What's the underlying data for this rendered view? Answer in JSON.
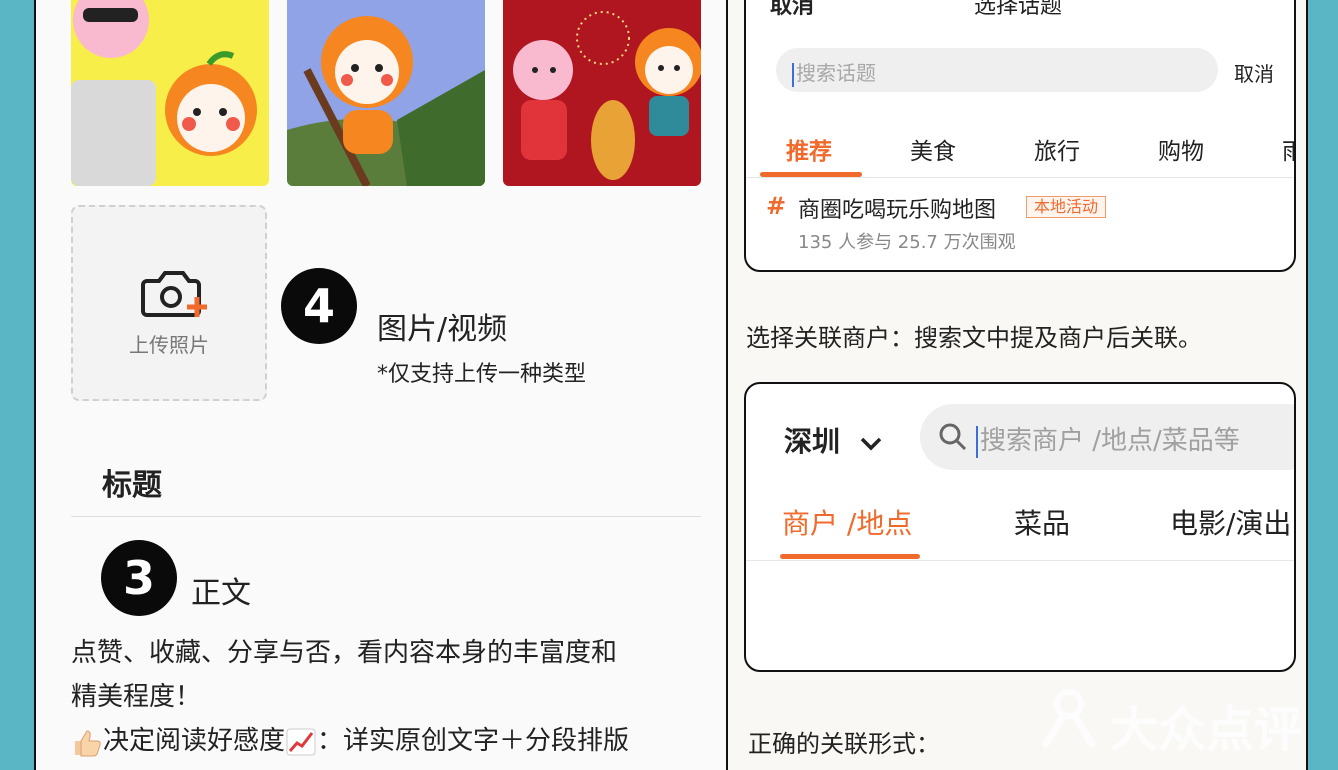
{
  "left": {
    "thumbnails": [
      "travel-image",
      "zongzi-image",
      "festival-image"
    ],
    "upload": {
      "label": "上传照片"
    },
    "step4": {
      "number": "4",
      "title": "图片/视频",
      "note": "*仅支持上传一种类型"
    },
    "title_field": {
      "label": "标题"
    },
    "step3": {
      "number": "3",
      "title": "正文"
    },
    "body_lines": [
      "点赞、收藏、分享与否，看内容本身的丰富度和",
      "精美程度！",
      "决定阅读好感度",
      "：详实原创文字＋分段排版"
    ]
  },
  "right": {
    "top_header": {
      "cancel": "取消",
      "title": "选择话题"
    },
    "topic_search": {
      "placeholder": "搜索话题",
      "cancel": "取消"
    },
    "topic_tabs": [
      "推荐",
      "美食",
      "旅行",
      "购物",
      "雨"
    ],
    "topic_item": {
      "hash": "#",
      "name": "商圈吃喝玩乐购地图",
      "badge": "本地活动",
      "stats": "135 人参与 25.7 万次围观"
    },
    "merchant_note": "选择关联商户：搜索文中提及商户后关联。",
    "merchant_card": {
      "city": "深圳",
      "search_placeholder": "搜索商户 /地点/菜品等",
      "tabs": [
        "商户 /地点",
        "菜品",
        "电影/演出"
      ]
    },
    "correct_form": "正确的关联形式：",
    "watermark": "大众点评"
  },
  "colors": {
    "accent": "#f06a2c",
    "frame": "#5ab5c4"
  }
}
